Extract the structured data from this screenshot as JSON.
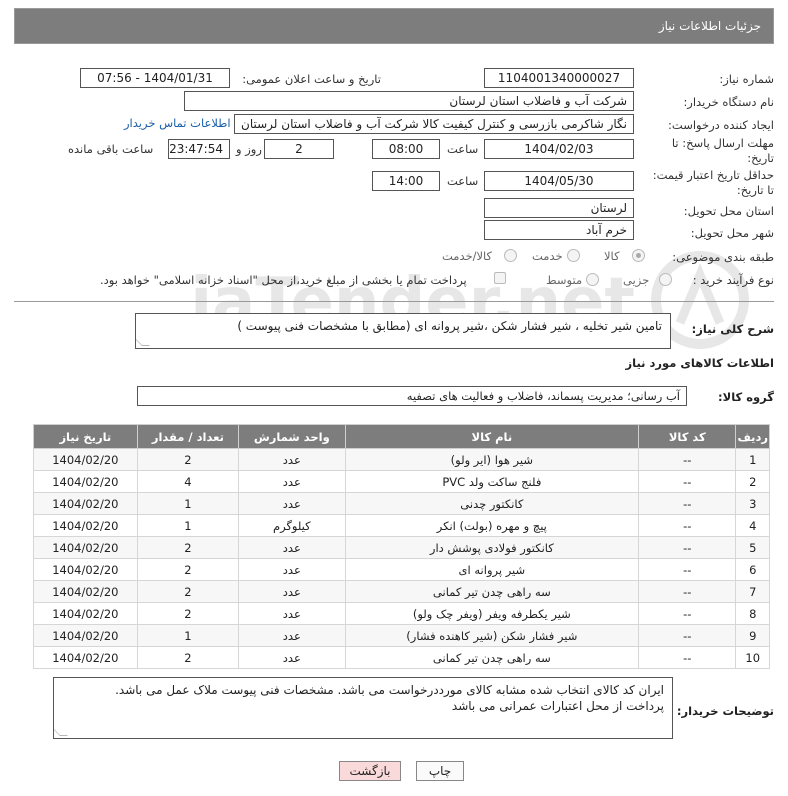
{
  "header": {
    "title": "جزئیات اطلاعات نیاز"
  },
  "form": {
    "need_number_label": "شماره نیاز:",
    "need_number": "1104001340000027",
    "announce_label": "تاریخ و ساعت اعلان عمومی:",
    "announce_value": "1404/01/31 - 07:56",
    "buyer_org_label": "نام دستگاه خریدار:",
    "buyer_org": "شرکت آب و فاضلاب استان لرستان",
    "creator_label": "ایجاد کننده درخواست:",
    "creator": "نگار شاکرمی بازرسی و کنترل کیفیت کالا شرکت آب و فاضلاب استان لرستان",
    "buyer_contact_link": "اطلاعات تماس خریدار",
    "deadline_label_1": "مهلت ارسال پاسخ: تا",
    "deadline_label_2": "تاریخ:",
    "deadline_date": "1404/02/03",
    "time_label": "ساعت",
    "deadline_time": "08:00",
    "days_value": "2",
    "days_label": "روز و",
    "remaining_time": "23:47:54",
    "remaining_label": "ساعت باقی مانده",
    "min_price_label_1": "حداقل تاریخ اعتبار قیمت:",
    "min_price_label_2": "تا تاریخ:",
    "min_price_date": "1404/05/30",
    "min_price_time": "14:00",
    "province_label": "استان محل تحویل:",
    "province": "لرستان",
    "city_label": "شهر محل تحویل:",
    "city": "خرم آباد",
    "category_label": "طبقه بندی موضوعی:",
    "category_options": [
      "کالا",
      "خدمت",
      "کالا/خدمت"
    ],
    "process_label": "نوع فرآیند خرید :",
    "process_options": [
      "جزیی",
      "متوسط"
    ],
    "process_note": "پرداخت تمام یا بخشی از مبلغ خرید،از محل \"اسناد خزانه اسلامی\" خواهد بود.",
    "summary_label": "شرح کلی نیاز:",
    "summary": "تامین شیر تخلیه ، شیر فشار شکن ،شیر پروانه ای (مطابق با مشخصات فنی پیوست )"
  },
  "goods": {
    "section_title": "اطلاعات کالاهای مورد نیاز",
    "group_label": "گروه کالا:",
    "group_value": "آب رسانی؛ مدیریت پسماند، فاضلاب و فعالیت های تصفیه",
    "columns": [
      "ردیف",
      "کد کالا",
      "نام کالا",
      "واحد شمارش",
      "تعداد / مقدار",
      "تاریخ نیاز"
    ],
    "rows": [
      [
        "1",
        "--",
        "شیر هوا (ایر ولو)",
        "عدد",
        "2",
        "1404/02/20"
      ],
      [
        "2",
        "--",
        "فلنج ساکت ولد PVC",
        "عدد",
        "4",
        "1404/02/20"
      ],
      [
        "3",
        "--",
        "کانکتور چدنی",
        "عدد",
        "1",
        "1404/02/20"
      ],
      [
        "4",
        "--",
        "پیچ و مهره (بولت) انکر",
        "کیلوگرم",
        "1",
        "1404/02/20"
      ],
      [
        "5",
        "--",
        "کانکتور فولادی پوشش دار",
        "عدد",
        "2",
        "1404/02/20"
      ],
      [
        "6",
        "--",
        "شیر پروانه ای",
        "عدد",
        "2",
        "1404/02/20"
      ],
      [
        "7",
        "--",
        "سه راهی چدن تیر کمانی",
        "عدد",
        "2",
        "1404/02/20"
      ],
      [
        "8",
        "--",
        "شیر یکطرفه ویفر (ویفر چک ولو)",
        "عدد",
        "2",
        "1404/02/20"
      ],
      [
        "9",
        "--",
        "شیر فشار شکن (شیر کاهنده فشار)",
        "عدد",
        "1",
        "1404/02/20"
      ],
      [
        "10",
        "--",
        "سه راهی چدن تیر کمانی",
        "عدد",
        "2",
        "1404/02/20"
      ]
    ]
  },
  "notes": {
    "label": "توضیحات خریدار:",
    "line1": "ایران کد کالای انتخاب شده مشابه کالای مورددرخواست می باشد. مشخصات فنی پیوست ملاک عمل می باشد.",
    "line2": "پرداخت از محل اعتبارات عمرانی می باشد"
  },
  "buttons": {
    "print": "چاپ",
    "back": "بازگشت"
  },
  "watermark": "AriaTender.net",
  "colors": {
    "header_bg": "#7d7d7d",
    "link": "#1a5fa8",
    "back_button_bg": "#f9d9d9"
  }
}
